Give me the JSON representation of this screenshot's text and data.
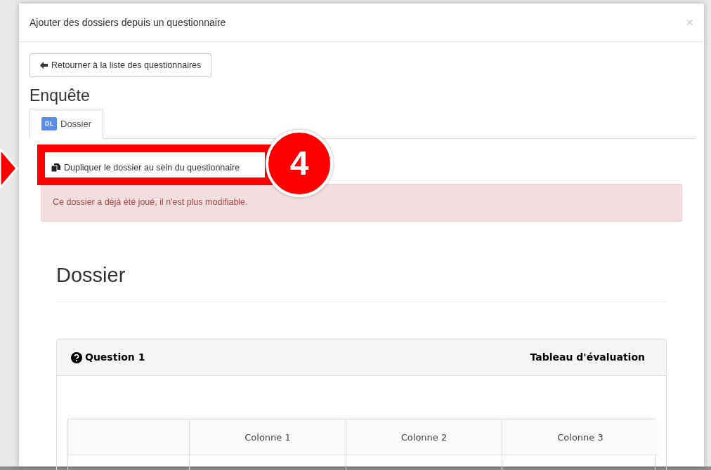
{
  "dialog": {
    "title": "Ajouter des dossiers depuis un questionnaire",
    "close": "×"
  },
  "back_button": "Retourner à la liste des questionnaires",
  "survey_title": "Enquête",
  "tabs": [
    {
      "badge": "DL",
      "label": "Dossier",
      "selected": true
    }
  ],
  "duplicate_link": "Dupliquer le dossier au sein du questionnaire",
  "alert": "Ce dossier a déjà été joué, il n'est plus modifiable.",
  "dossier_heading": "Dossier",
  "question": {
    "title": "Question 1",
    "type_label": "Tableau d'évaluation",
    "columns": [
      "Colonne 1",
      "Colonne 2",
      "Colonne 3"
    ]
  },
  "annotation": {
    "number": "4"
  }
}
